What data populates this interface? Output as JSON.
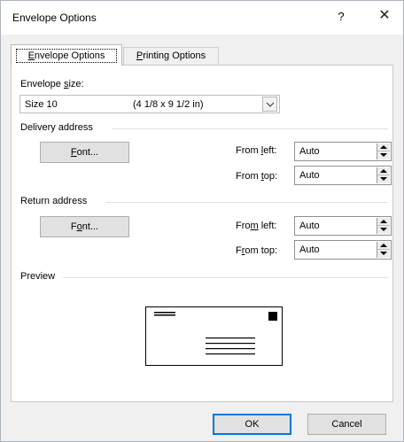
{
  "window": {
    "title": "Envelope Options",
    "help_label": "?",
    "close_label": "✕"
  },
  "tabs": [
    {
      "label_pre": "",
      "label_key": "E",
      "label_post": "nvelope Options",
      "active": true
    },
    {
      "label_pre": "",
      "label_key": "P",
      "label_post": "rinting Options",
      "active": false
    }
  ],
  "envelope_size": {
    "label_pre": "Envelope ",
    "label_key": "s",
    "label_post": "ize:",
    "selected_name": "Size 10",
    "selected_dim": "(4 1/8 x 9 1/2 in)"
  },
  "delivery": {
    "group_label": "Delivery address",
    "font_pre": "",
    "font_key": "F",
    "font_post": "ont...",
    "from_left_pre": "From ",
    "from_left_key": "l",
    "from_left_post": "eft:",
    "from_left_value": "Auto",
    "from_top_pre": "From ",
    "from_top_key": "t",
    "from_top_post": "op:",
    "from_top_value": "Auto"
  },
  "return": {
    "group_label": "Return address",
    "font_pre": "F",
    "font_key": "o",
    "font_post": "nt...",
    "from_left_pre": "Fro",
    "from_left_key": "m",
    "from_left_post": " left:",
    "from_left_value": "Auto",
    "from_top_pre": "F",
    "from_top_key": "r",
    "from_top_post": "om top:",
    "from_top_value": "Auto"
  },
  "preview": {
    "group_label": "Preview"
  },
  "buttons": {
    "ok_label": "OK",
    "cancel_label": "Cancel"
  }
}
